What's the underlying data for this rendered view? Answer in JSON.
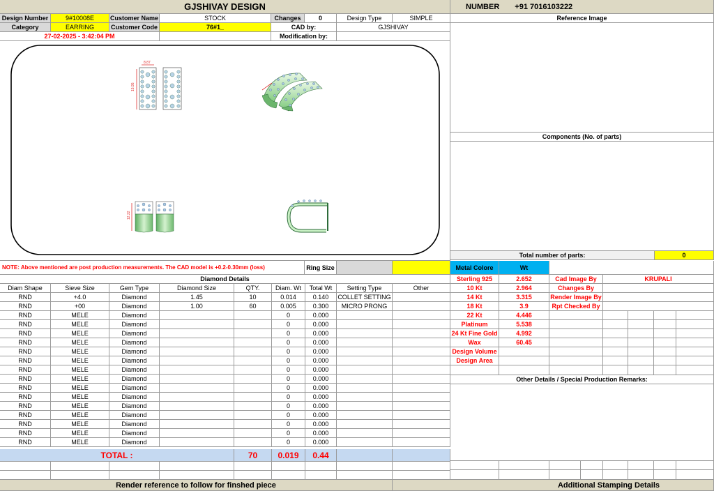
{
  "header": {
    "title": "GJSHIVAY DESIGN",
    "number_label": "NUMBER",
    "number_value": "+91 7016103222"
  },
  "info": {
    "design_number_label": "Design Number",
    "design_number": "9#10008E",
    "customer_name_label": "Customer Name",
    "customer_name": "STOCK",
    "changes_label": "Changes By",
    "changes_value": "0",
    "design_type_label": "Design Type",
    "design_type": "SIMPLE",
    "category_label": "Category",
    "category": "EARRING",
    "customer_code_label": "Customer Code",
    "customer_code": "76#1_",
    "cad_by_label": "CAD by:",
    "cad_by": "GJSHIVAY",
    "timestamp": "27-02-2025 - 3:42:04 PM",
    "modification_label": "Modification by:",
    "modification": ""
  },
  "drawing": {
    "dim_width": "8.87",
    "dim_height": "15.95",
    "dim_side": "12.22"
  },
  "right_panel": {
    "reference_image_label": "Reference Image",
    "components_label": "Components (No. of parts)",
    "total_parts_label": "Total number of parts:",
    "total_parts_value": "0",
    "metal_colore_label": "Metal Colore",
    "wt_label": "Wt",
    "metals": [
      {
        "name": "Sterling 925",
        "wt": "2.652"
      },
      {
        "name": "10 Kt",
        "wt": "2.964"
      },
      {
        "name": "14 Kt",
        "wt": "3.315"
      },
      {
        "name": "18 Kt",
        "wt": "3.9"
      },
      {
        "name": "22 Kt",
        "wt": "4.446"
      },
      {
        "name": "Platinum",
        "wt": "5.538"
      },
      {
        "name": "24 Kt Fine Gold",
        "wt": "4.992"
      },
      {
        "name": "Wax",
        "wt": "60.45"
      },
      {
        "name": "Design Volume",
        "wt": ""
      },
      {
        "name": "Design Area",
        "wt": ""
      }
    ],
    "credits": [
      {
        "label": "Cad Image By",
        "value": "KRUPALI"
      },
      {
        "label": "Changes By",
        "value": ""
      },
      {
        "label": "Render Image By",
        "value": ""
      },
      {
        "label": "Rpt Checked By",
        "value": ""
      }
    ],
    "other_details_label": "Other Details / Special Production Remarks:",
    "additional_stamping_label": "Additional Stamping Details"
  },
  "note": {
    "text": "NOTE: Above mentioned are post production measurements. The CAD model is +0.2-0.30mm (loss)",
    "ring_size_label": "Ring Size",
    "ring_size_value": ""
  },
  "diamond": {
    "title": "Diamond Details",
    "columns": [
      "Diam Shape",
      "Sieve Size",
      "Gem Type",
      "Diamond Size",
      "QTY.",
      "Diam. Wt",
      "Total Wt",
      "Setting Type",
      "Other"
    ],
    "rows": [
      [
        "RND",
        "+4.0",
        "Diamond",
        "1.45",
        "10",
        "0.014",
        "0.140",
        "COLLET SETTING",
        ""
      ],
      [
        "RND",
        "+00",
        "Diamond",
        "1.00",
        "60",
        "0.005",
        "0.300",
        "MICRO PRONG",
        ""
      ],
      [
        "RND",
        "MELE",
        "Diamond",
        "",
        "",
        "0",
        "0.000",
        "",
        ""
      ],
      [
        "RND",
        "MELE",
        "Diamond",
        "",
        "",
        "0",
        "0.000",
        "",
        ""
      ],
      [
        "RND",
        "MELE",
        "Diamond",
        "",
        "",
        "0",
        "0.000",
        "",
        ""
      ],
      [
        "RND",
        "MELE",
        "Diamond",
        "",
        "",
        "0",
        "0.000",
        "",
        ""
      ],
      [
        "RND",
        "MELE",
        "Diamond",
        "",
        "",
        "0",
        "0.000",
        "",
        ""
      ],
      [
        "RND",
        "MELE",
        "Diamond",
        "",
        "",
        "0",
        "0.000",
        "",
        ""
      ],
      [
        "RND",
        "MELE",
        "Diamond",
        "",
        "",
        "0",
        "0.000",
        "",
        ""
      ],
      [
        "RND",
        "MELE",
        "Diamond",
        "",
        "",
        "0",
        "0.000",
        "",
        ""
      ],
      [
        "RND",
        "MELE",
        "Diamond",
        "",
        "",
        "0",
        "0.000",
        "",
        ""
      ],
      [
        "RND",
        "MELE",
        "Diamond",
        "",
        "",
        "0",
        "0.000",
        "",
        ""
      ],
      [
        "RND",
        "MELE",
        "Diamond",
        "",
        "",
        "0",
        "0.000",
        "",
        ""
      ],
      [
        "RND",
        "MELE",
        "Diamond",
        "",
        "",
        "0",
        "0.000",
        "",
        ""
      ],
      [
        "RND",
        "MELE",
        "Diamond",
        "",
        "",
        "0",
        "0.000",
        "",
        ""
      ],
      [
        "RND",
        "MELE",
        "Diamond",
        "",
        "",
        "0",
        "0.000",
        "",
        ""
      ],
      [
        "RND",
        "MELE",
        "Diamond",
        "",
        "",
        "0",
        "0.000",
        "",
        ""
      ]
    ],
    "total_label": "TOTAL :",
    "total_qty": "70",
    "total_diam_wt": "0.019",
    "total_wt": "0.44"
  },
  "footer": {
    "render_reference": "Render reference to follow for finshed piece"
  },
  "colors": {
    "yellow": "#ffff00",
    "label_grey": "#d9d9d9",
    "header_tan": "#ddd9c4",
    "total_blue": "#c5d9f1",
    "metal_blue": "#00b0f0",
    "red_text": "#ff0000",
    "model_green": "#a8e0a0"
  }
}
